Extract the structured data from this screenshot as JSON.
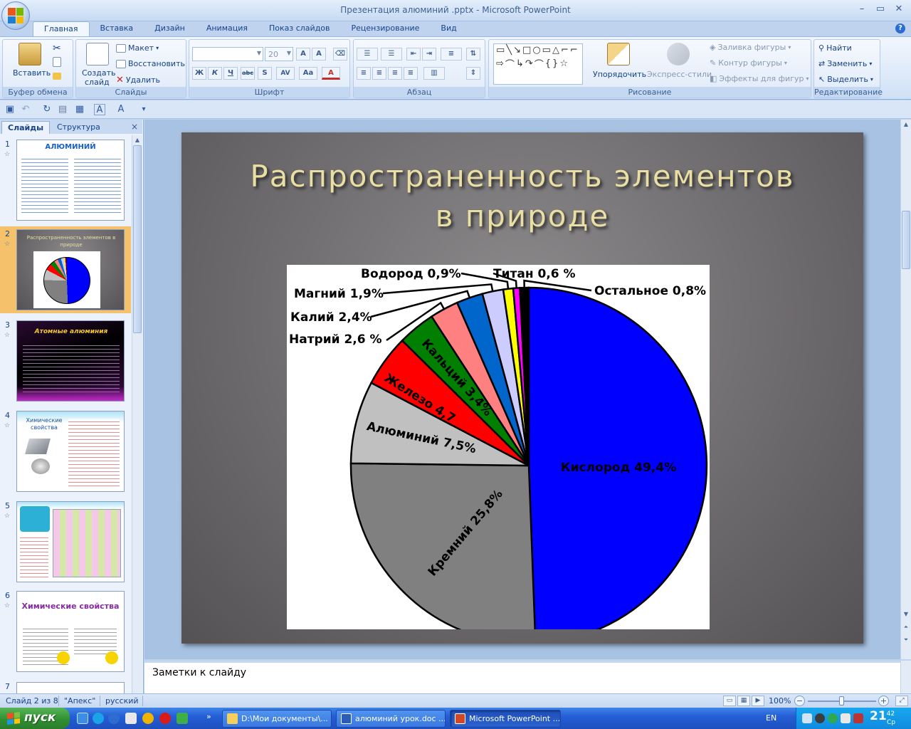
{
  "window": {
    "title": "Презентация алюминий .pptx - Microsoft PowerPoint",
    "controls": [
      "–",
      "▭",
      "✕"
    ]
  },
  "ribbon_tabs": [
    "Главная",
    "Вставка",
    "Дизайн",
    "Анимация",
    "Показ слайдов",
    "Рецензирование",
    "Вид"
  ],
  "ribbon": {
    "clipboard": {
      "paste": "Вставить",
      "label": "Буфер обмена"
    },
    "slides": {
      "create": "Создать",
      "create2": "слайд",
      "layout": "Макет",
      "reset": "Восстановить",
      "delete": "Удалить",
      "label": "Слайды"
    },
    "font": {
      "font_name": "",
      "font_size": "20",
      "label": "Шрифт"
    },
    "paragraph": {
      "label": "Абзац"
    },
    "drawing": {
      "arrange": "Упорядочить",
      "quick_styles": "Экспресс-стили",
      "fill": "Заливка фигуры",
      "outline": "Контур фигуры",
      "effects": "Эффекты для фигур",
      "label": "Рисование"
    },
    "editing": {
      "find": "Найти",
      "replace": "Заменить",
      "select": "Выделить",
      "label": "Редактирование"
    }
  },
  "slide_pane": {
    "tab_slides": "Слайды",
    "tab_outline": "Структура",
    "close": "×",
    "thumbnails": [
      {
        "num": "1",
        "title": "АЛЮМИНИЙ"
      },
      {
        "num": "2",
        "title": "Распространенность элементов в природе"
      },
      {
        "num": "3",
        "title": "Атомные алюминия"
      },
      {
        "num": "4",
        "title": "Химические свойства"
      },
      {
        "num": "5",
        "title": ""
      },
      {
        "num": "6",
        "title": "Химические свойства"
      },
      {
        "num": "7",
        "title": ""
      }
    ]
  },
  "slide": {
    "title_line1": "Распространенность  элементов",
    "title_line2": "в природе"
  },
  "chart_data": {
    "type": "pie",
    "title": "",
    "series": [
      {
        "name": "Кислород",
        "value": 49.4,
        "label": "Кислород 49,4%",
        "color": "#0000ff"
      },
      {
        "name": "Кремний",
        "value": 25.8,
        "label": "Кремний 25,8%",
        "color": "#808080"
      },
      {
        "name": "Алюминий",
        "value": 7.5,
        "label": "Алюминий 7,5%",
        "color": "#c0c0c0"
      },
      {
        "name": "Железо",
        "value": 4.7,
        "label": "Железо 4,7",
        "color": "#ff0000"
      },
      {
        "name": "Кальций",
        "value": 3.4,
        "label": "Кальций 3,4%",
        "color": "#007f00"
      },
      {
        "name": "Натрий",
        "value": 2.6,
        "label": "Натрий 2,6 %",
        "color": "#ff8080"
      },
      {
        "name": "Калий",
        "value": 2.4,
        "label": "Калий 2,4%",
        "color": "#0066cc"
      },
      {
        "name": "Магний",
        "value": 1.9,
        "label": "Магний 1,9%",
        "color": "#ccccff"
      },
      {
        "name": "Водород",
        "value": 0.9,
        "label": "Водород 0,9%",
        "color": "#ffff00"
      },
      {
        "name": "Титан",
        "value": 0.6,
        "label": "Титан 0,6 %",
        "color": "#ff00ff"
      },
      {
        "name": "Остальное",
        "value": 0.8,
        "label": "Остальное 0,8%",
        "color": "#000000"
      }
    ]
  },
  "notes": {
    "placeholder": "Заметки к слайду"
  },
  "status": {
    "slide_info": "Слайд 2 из 8",
    "theme": "\"Апекс\"",
    "language": "русский",
    "zoom": "100%",
    "zoom_fraction": 0.5
  },
  "taskbar": {
    "start": "пуск",
    "tasks": [
      "D:\\Мои документы\\...",
      "алюминий урок.doc ...",
      "Microsoft PowerPoint ..."
    ],
    "lang": "EN",
    "time": "21",
    "time_min": "42",
    "time_sub": "Ср"
  }
}
